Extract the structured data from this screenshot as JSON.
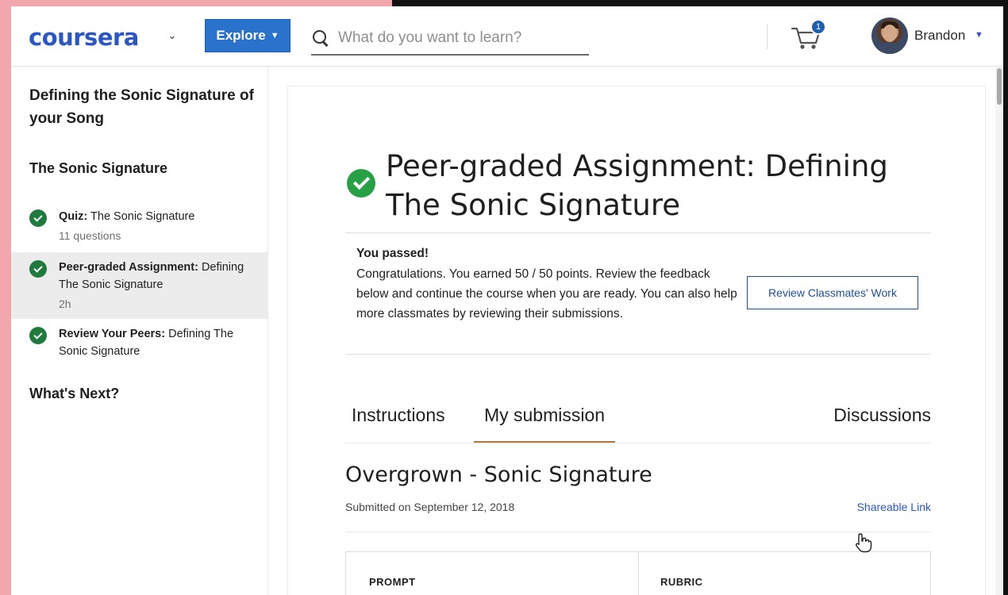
{
  "header": {
    "logo": "coursera",
    "explore_label": "Explore",
    "search_placeholder": "What do you want to learn?",
    "cart_count": "1",
    "user_name": "Brandon"
  },
  "sidebar": {
    "module_title": "Defining the Sonic Signature of your Song",
    "lesson_title": "The Sonic Signature",
    "items": [
      {
        "type": "Quiz:",
        "title": " The Sonic Signature",
        "meta": "11 questions",
        "completed": true,
        "active": false
      },
      {
        "type": "Peer-graded Assignment:",
        "title": " Defining The Sonic Signature",
        "meta": "2h",
        "completed": true,
        "active": true
      },
      {
        "type": "Review Your Peers:",
        "title": " Defining The Sonic Signature",
        "meta": "",
        "completed": true,
        "active": false
      }
    ],
    "whats_next": "What's Next?"
  },
  "main": {
    "title": "Peer-graded Assignment: Defining The Sonic Signature",
    "passed_title": "You passed!",
    "passed_body": "Congratulations. You earned 50 / 50 points. Review the feedback below and continue the course when you are ready. You can also help more classmates by reviewing their submissions.",
    "review_button": "Review Classmates' Work",
    "tabs": [
      {
        "label": "Instructions",
        "active": false
      },
      {
        "label": "My submission",
        "active": true
      },
      {
        "label": "Discussions",
        "active": false
      }
    ],
    "submission_title": "Overgrown - Sonic Signature",
    "submitted_on": "Submitted on September 12, 2018",
    "shareable_link": "Shareable Link",
    "columns": [
      "PROMPT",
      "RUBRIC"
    ]
  },
  "colors": {
    "brand": "#2a56c6",
    "explore_bg": "#2a73cc",
    "check_green": "#1f7a3e",
    "tab_underline": "#b07a3f"
  }
}
